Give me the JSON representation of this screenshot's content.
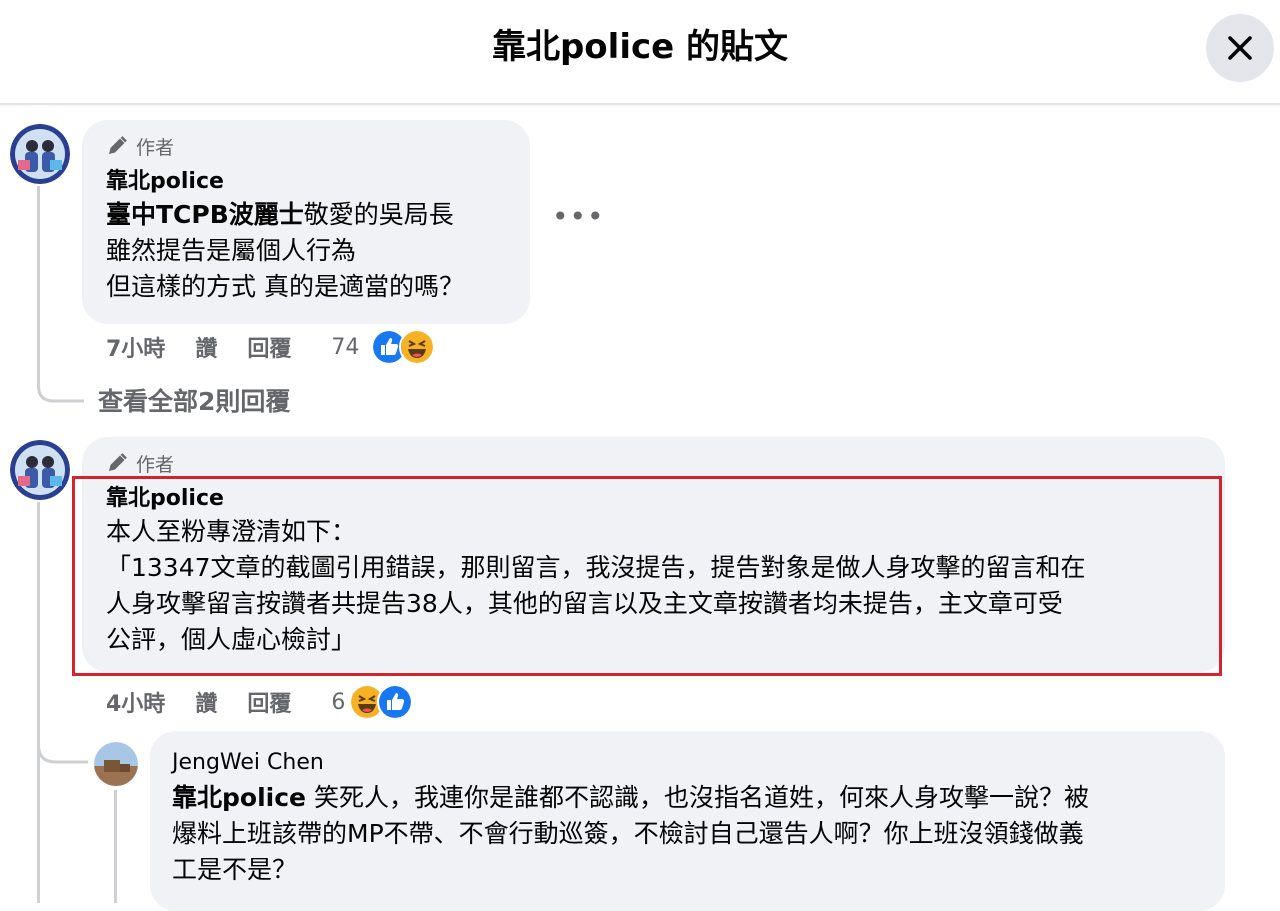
{
  "header": {
    "title": "靠北police 的貼文"
  },
  "comments": [
    {
      "badge": "作者",
      "author": "靠北police",
      "tag": "臺中TCPB波麗士",
      "line1_rest": "敬愛的吳局長",
      "line2": "雖然提告是屬個人行為",
      "line3": "但這樣的方式 真的是適當的嗎？",
      "time": "7小時",
      "like": "讚",
      "reply": "回覆",
      "reaction_count": "74"
    },
    {
      "badge": "作者",
      "author": "靠北police",
      "line1": "本人至粉專澄清如下：",
      "line2": "「13347文章的截圖引用錯誤，那則留言，我沒提告，提告對象是做人身攻擊的留言和在",
      "line3": "人身攻擊留言按讚者共提告38人，其他的留言以及主文章按讚者均未提告，主文章可受",
      "line4": "公評，個人虛心檢討」",
      "time": "4小時",
      "like": "讚",
      "reply": "回覆",
      "reaction_count": "6"
    }
  ],
  "view_replies": "查看全部2則回覆",
  "reply": {
    "author": "JengWei Chen",
    "mention": "靠北police",
    "line1_rest": " 笑死人，我連你是誰都不認識，也沒指名道姓，何來人身攻擊一說？被",
    "line2": "爆料上班該帶的MP不帶、不會行動巡簽，不檢討自己還告人啊？你上班沒領錢做義",
    "line3": "工是不是？"
  },
  "icons": [
    "close-icon",
    "pencil-icon",
    "more-icon",
    "like-icon",
    "haha-icon"
  ],
  "colors": {
    "like_blue": "#1877f2",
    "highlight_red": "#d6232b",
    "bubble_gray": "#f0f2f5"
  }
}
